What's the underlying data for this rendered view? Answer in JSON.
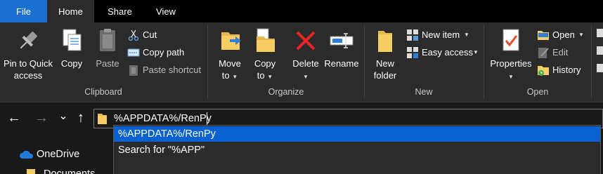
{
  "tabs": {
    "file": "File",
    "home": "Home",
    "share": "Share",
    "view": "View"
  },
  "ribbon": {
    "clipboard": {
      "label": "Clipboard",
      "pin_line1": "Pin to Quick",
      "pin_line2": "access",
      "copy": "Copy",
      "paste": "Paste",
      "cut": "Cut",
      "copy_path": "Copy path",
      "paste_shortcut": "Paste shortcut"
    },
    "organize": {
      "label": "Organize",
      "move_line1": "Move",
      "move_line2": "to",
      "copy_line1": "Copy",
      "copy_line2": "to",
      "delete": "Delete",
      "rename": "Rename"
    },
    "new": {
      "label": "New",
      "folder_line1": "New",
      "folder_line2": "folder",
      "new_item": "New item",
      "easy_access": "Easy access"
    },
    "open": {
      "label": "Open",
      "properties": "Properties",
      "open": "Open",
      "edit": "Edit",
      "history": "History"
    }
  },
  "address": {
    "value": "%APPDATA%/RenPy",
    "suggestions": [
      "%APPDATA%/RenPy",
      "Search for \"%APP\""
    ]
  },
  "nav": {
    "back": "←",
    "forward": "→",
    "recent": "⌄",
    "up": "↑"
  },
  "tree": {
    "onedrive": "OneDrive",
    "documents": "Documents"
  },
  "colors": {
    "accent": "#0a62d0",
    "file_tab": "#1a6fd1",
    "ribbon_bg": "#2b2b2b"
  }
}
